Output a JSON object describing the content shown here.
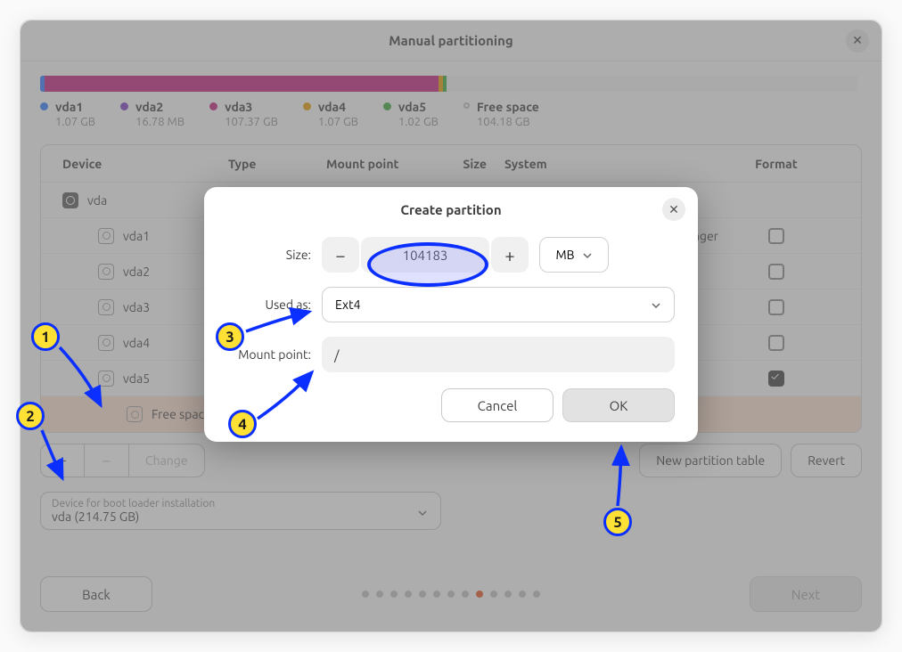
{
  "window": {
    "title": "Manual partitioning"
  },
  "diskbar": {
    "segments": [
      {
        "color": "#2d7bff",
        "width": 0.5
      },
      {
        "color": "#c41d7f",
        "width": 0.01
      },
      {
        "color": "#c41d7f",
        "width": 48
      },
      {
        "color": "#e99b00",
        "width": 0.5
      },
      {
        "color": "#3aa93a",
        "width": 0.5
      },
      {
        "color": "#f4f4f4",
        "width": 50
      }
    ]
  },
  "legend": [
    {
      "color": "#2d7bff",
      "name": "vda1",
      "size": "1.07 GB"
    },
    {
      "color": "#7f3ac4",
      "name": "vda2",
      "size": "16.78 MB"
    },
    {
      "color": "#c41d7f",
      "name": "vda3",
      "size": "107.37 GB"
    },
    {
      "color": "#e99b00",
      "name": "vda4",
      "size": "1.07 GB"
    },
    {
      "color": "#3aa93a",
      "name": "vda5",
      "size": "1.02 GB"
    },
    {
      "color": "#ffffff",
      "name": "Free space",
      "size": "104.18 GB",
      "hollow": true
    }
  ],
  "table": {
    "headers": {
      "device": "Device",
      "type": "Type",
      "mount": "Mount point",
      "size": "Size",
      "system": "System",
      "format": "Format"
    },
    "rows": [
      {
        "device": "vda",
        "indent": 0,
        "icon": "solid"
      },
      {
        "device": "vda1",
        "indent": 1,
        "icon": "hollow",
        "system_tail": "nager",
        "format": false
      },
      {
        "device": "vda2",
        "indent": 1,
        "icon": "hollow",
        "format": false
      },
      {
        "device": "vda3",
        "indent": 1,
        "icon": "hollow",
        "format": false
      },
      {
        "device": "vda4",
        "indent": 1,
        "icon": "hollow",
        "format": false
      },
      {
        "device": "vda5",
        "indent": 1,
        "icon": "hollow",
        "format": true
      },
      {
        "device": "Free space",
        "indent": 2,
        "icon": "hollow",
        "selected": true
      }
    ]
  },
  "toolbar": {
    "add": "+",
    "remove": "−",
    "change": "Change",
    "new_table": "New partition table",
    "revert": "Revert"
  },
  "bootloader": {
    "label": "Device for boot loader installation",
    "value": "vda  (214.75 GB)"
  },
  "footer": {
    "back": "Back",
    "next": "Next",
    "total_dots": 13,
    "active_dot": 8
  },
  "modal": {
    "title": "Create partition",
    "size": {
      "label": "Size:",
      "value": "104183",
      "unit": "MB"
    },
    "used_as": {
      "label": "Used as:",
      "value": "Ext4"
    },
    "mount": {
      "label": "Mount point:",
      "value": "/"
    },
    "cancel": "Cancel",
    "ok": "OK"
  },
  "annotations": {
    "steps": [
      "1",
      "2",
      "3",
      "4",
      "5"
    ]
  }
}
